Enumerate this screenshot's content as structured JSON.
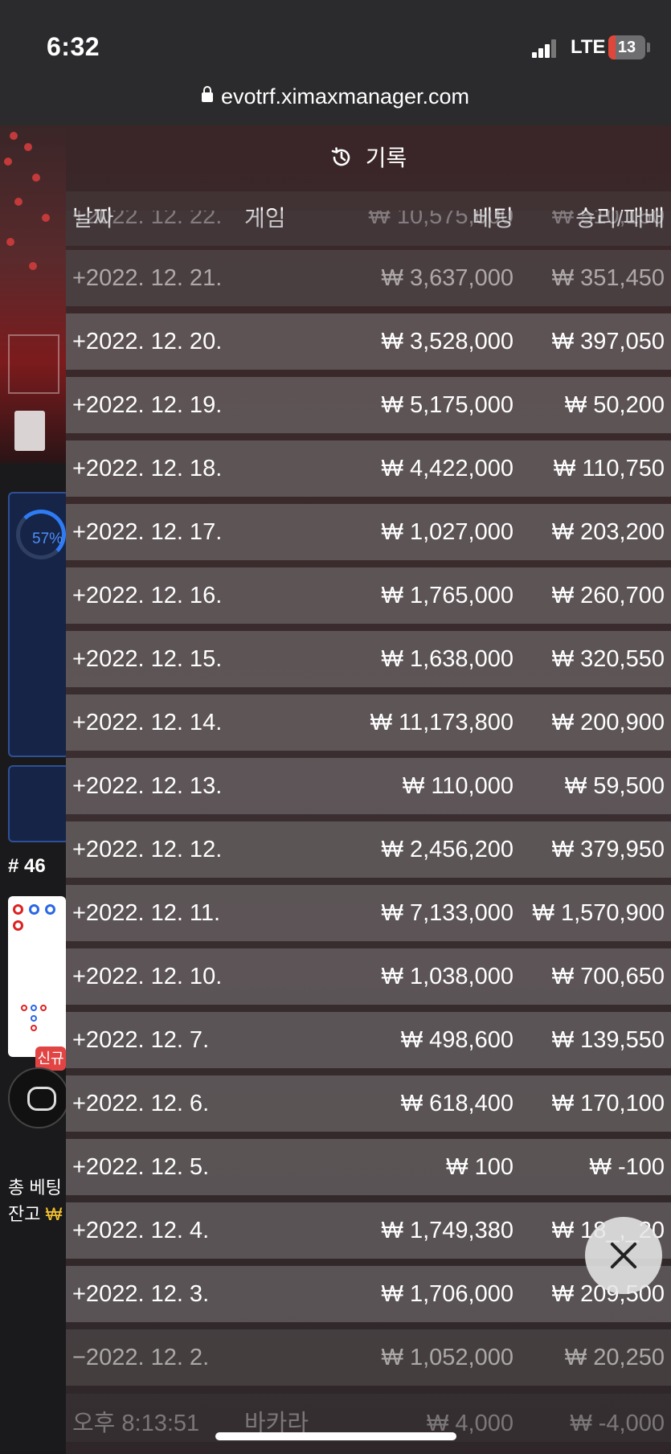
{
  "status_bar": {
    "time": "6:32",
    "network": "LTE",
    "battery": "13"
  },
  "browser": {
    "url": "evotrf.ximaxmanager.com"
  },
  "background": {
    "percent": "57%",
    "round": "# 46",
    "new_tag": "신규",
    "total_bet_label": "총 베팅",
    "balance_label": "잔고",
    "balance_currency": "₩"
  },
  "history": {
    "title": "기록",
    "icon": "history-clock-icon",
    "columns": {
      "date": "날짜",
      "game": "게임",
      "bet": "베팅",
      "result": "승리/패배"
    },
    "top_partial_row": {
      "date": "+2022. 12. 22.",
      "bet": "₩ 10,575,000",
      "result": "₩ 510,150"
    },
    "rows": [
      {
        "date": "+2022. 12. 21.",
        "bet": "₩ 3,637,000",
        "result": "₩ 351,450"
      },
      {
        "date": "+2022. 12. 20.",
        "bet": "₩ 3,528,000",
        "result": "₩ 397,050"
      },
      {
        "date": "+2022. 12. 19.",
        "bet": "₩ 5,175,000",
        "result": "₩ 50,200"
      },
      {
        "date": "+2022. 12. 18.",
        "bet": "₩ 4,422,000",
        "result": "₩ 110,750"
      },
      {
        "date": "+2022. 12. 17.",
        "bet": "₩ 1,027,000",
        "result": "₩ 203,200"
      },
      {
        "date": "+2022. 12. 16.",
        "bet": "₩ 1,765,000",
        "result": "₩ 260,700"
      },
      {
        "date": "+2022. 12. 15.",
        "bet": "₩ 1,638,000",
        "result": "₩ 320,550"
      },
      {
        "date": "+2022. 12. 14.",
        "bet": "₩ 11,173,800",
        "result": "₩ 200,900"
      },
      {
        "date": "+2022. 12. 13.",
        "bet": "₩ 110,000",
        "result": "₩ 59,500"
      },
      {
        "date": "+2022. 12. 12.",
        "bet": "₩ 2,456,200",
        "result": "₩ 379,950"
      },
      {
        "date": "+2022. 12. 11.",
        "bet": "₩ 7,133,000",
        "result": "₩ 1,570,900"
      },
      {
        "date": "+2022. 12. 10.",
        "bet": "₩ 1,038,000",
        "result": "₩ 700,650"
      },
      {
        "date": "+2022. 12. 7.",
        "bet": "₩ 498,600",
        "result": "₩ 139,550"
      },
      {
        "date": "+2022. 12. 6.",
        "bet": "₩ 618,400",
        "result": "₩ 170,100"
      },
      {
        "date": "+2022. 12. 5.",
        "bet": "₩ 100",
        "result": "₩ -100"
      },
      {
        "date": "+2022. 12. 4.",
        "bet": "₩ 1,749,380",
        "result": "₩ 18_,_20"
      },
      {
        "date": "+2022. 12. 3.",
        "bet": "₩ 1,706,000",
        "result": "₩ 209,500"
      },
      {
        "date": "−2022. 12. 2.",
        "bet": "₩ 1,052,000",
        "result": "₩ 20,250"
      }
    ],
    "bottom_partial_row": {
      "date": "오후 8:13:51",
      "game": "바카라",
      "bet": "₩ 4,000",
      "result": "₩ -4,000"
    }
  }
}
